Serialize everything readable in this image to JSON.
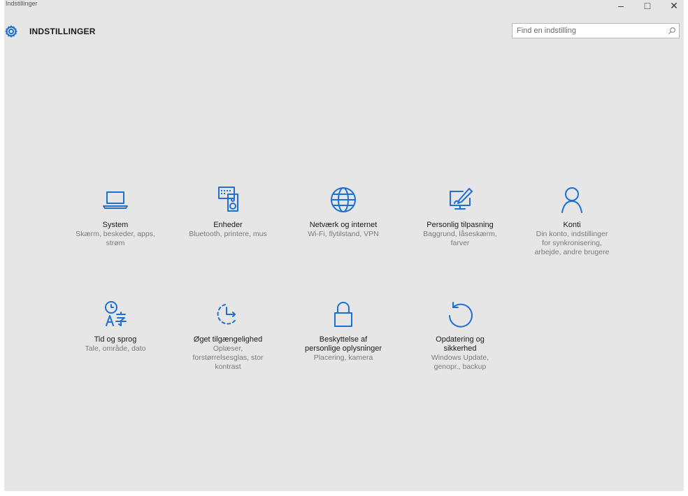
{
  "window": {
    "title": "Indstillinger",
    "minimize_glyph": "–",
    "maximize_glyph": "□",
    "close_glyph": "✕"
  },
  "header": {
    "icon": "gear-icon",
    "title": "INDSTILLINGER",
    "search_placeholder": "Find en indstilling",
    "search_icon": "search-icon"
  },
  "accent_color": "#1d6fd1",
  "tiles": [
    {
      "icon": "laptop-icon",
      "label": "System",
      "desc": "Skærm, beskeder, apps,\nstrøm"
    },
    {
      "icon": "devices-icon",
      "label": "Enheder",
      "desc": "Bluetooth, printere, mus"
    },
    {
      "icon": "globe-icon",
      "label": "Netværk og internet",
      "desc": "Wi-Fi, flytilstand, VPN"
    },
    {
      "icon": "personalization-icon",
      "label": "Personlig tilpasning",
      "desc": "Baggrund, låseskærm,\nfarver"
    },
    {
      "icon": "person-icon",
      "label": "Konti",
      "desc": "Din konto, indstillinger\nfor synkronisering,\narbejde, andre brugere"
    },
    {
      "icon": "time-language-icon",
      "label": "Tid og sprog",
      "desc": "Tale, område, dato"
    },
    {
      "icon": "ease-of-access-icon",
      "label": "Øget tilgængelighed",
      "desc": "Oplæser,\nforstørrelsesglas, stor\nkontrast"
    },
    {
      "icon": "lock-icon",
      "label": "Beskyttelse af\npersonlige oplysninger",
      "desc": "Placering, kamera"
    },
    {
      "icon": "update-icon",
      "label": "Opdatering og\nsikkerhed",
      "desc": "Windows Update,\ngenopr., backup"
    }
  ]
}
